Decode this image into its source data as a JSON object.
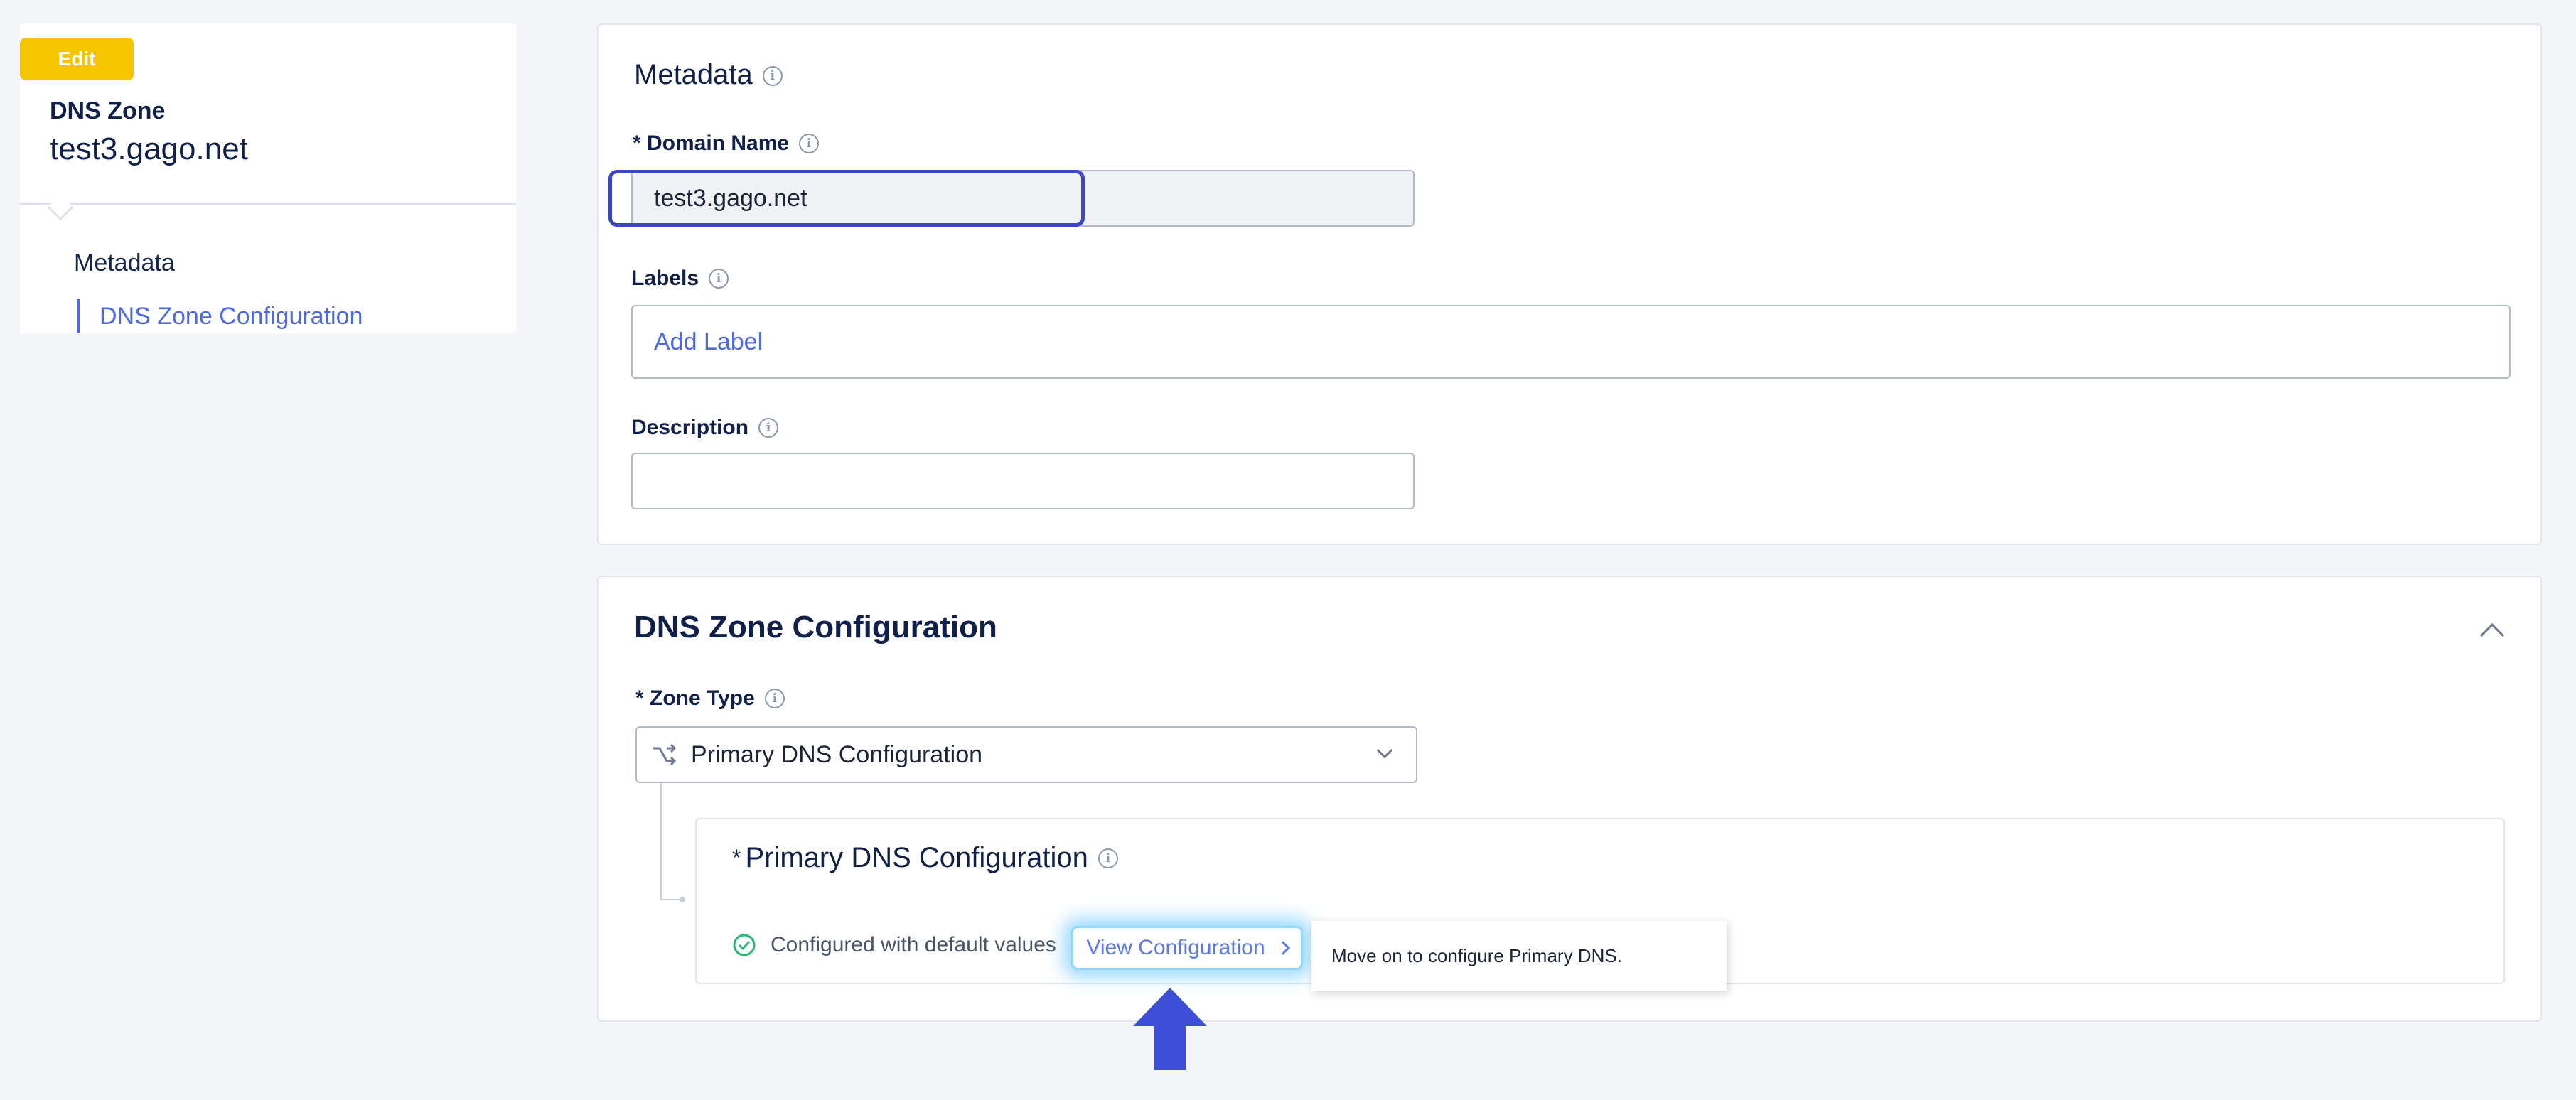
{
  "nav": {
    "badge": "Edit",
    "kicker": "DNS Zone",
    "title": "test3.gago.net",
    "items": [
      {
        "label": "Metadata",
        "active": false
      },
      {
        "label": "DNS Zone Configuration",
        "active": true
      }
    ]
  },
  "metadata": {
    "title": "Metadata",
    "domain_name": {
      "label": "* Domain Name",
      "value": "test3.gago.net"
    },
    "labels": {
      "label": "Labels",
      "placeholder": "Add Label"
    },
    "description": {
      "label": "Description",
      "value": ""
    }
  },
  "dns_config": {
    "title": "DNS Zone Configuration",
    "zone_type": {
      "label": "* Zone Type",
      "value": "Primary DNS Configuration"
    },
    "primary": {
      "star": "*",
      "title": "Primary DNS Configuration",
      "status": "Configured with default values",
      "view_link": "View Configuration"
    }
  },
  "tooltip": {
    "text": "Move on to configure Primary DNS."
  },
  "colors": {
    "accent": "#4d68e6",
    "badge": "#f7c400",
    "focus": "#3a46c4",
    "success": "#2bb673",
    "pointer": "#3d4fd8"
  },
  "icons": [
    "info-icon",
    "chevron-up-icon",
    "chevron-down-icon",
    "route-icon",
    "check-circle-icon",
    "chevron-right-icon",
    "arrow-up-icon"
  ]
}
